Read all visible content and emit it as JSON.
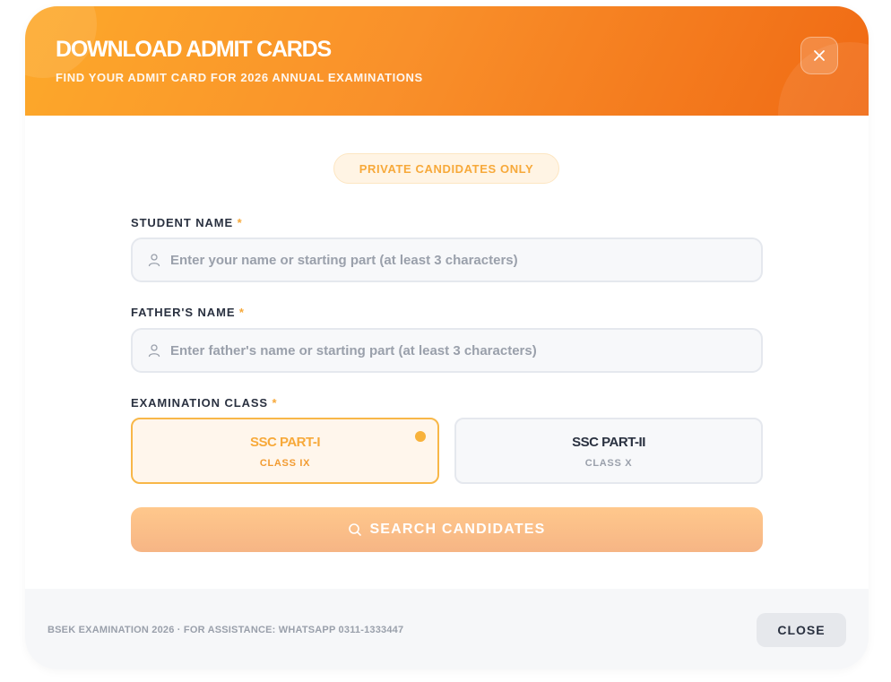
{
  "header": {
    "title": "DOWNLOAD ADMIT CARDS",
    "subtitle": "FIND YOUR ADMIT CARD FOR 2026 ANNUAL EXAMINATIONS",
    "close_icon": "close-icon"
  },
  "badge": "PRIVATE CANDIDATES ONLY",
  "fields": {
    "student_name": {
      "label": "STUDENT NAME",
      "required_mark": "*",
      "placeholder": "Enter your name or starting part (at least 3 characters)",
      "value": "",
      "icon": "user-icon"
    },
    "father_name": {
      "label": "FATHER'S NAME",
      "required_mark": "*",
      "placeholder": "Enter father's name or starting part (at least 3 characters)",
      "value": "",
      "icon": "user-icon"
    },
    "exam_class": {
      "label": "EXAMINATION CLASS",
      "required_mark": "*",
      "options": [
        {
          "name": "SSC PART-I",
          "sub": "CLASS IX",
          "selected": true
        },
        {
          "name": "SSC PART-II",
          "sub": "CLASS X",
          "selected": false
        }
      ]
    }
  },
  "search_button": {
    "label": "SEARCH CANDIDATES",
    "icon": "search-icon"
  },
  "footer": {
    "info": "BSEK EXAMINATION 2026 · FOR ASSISTANCE: WHATSAPP 0311-1333447",
    "close_label": "CLOSE"
  },
  "colors": {
    "accent": "#f7a93a",
    "header_start": "#fda92a",
    "header_end": "#f06a14",
    "text_dark": "#2a3140",
    "text_muted": "#9aa0ab"
  }
}
